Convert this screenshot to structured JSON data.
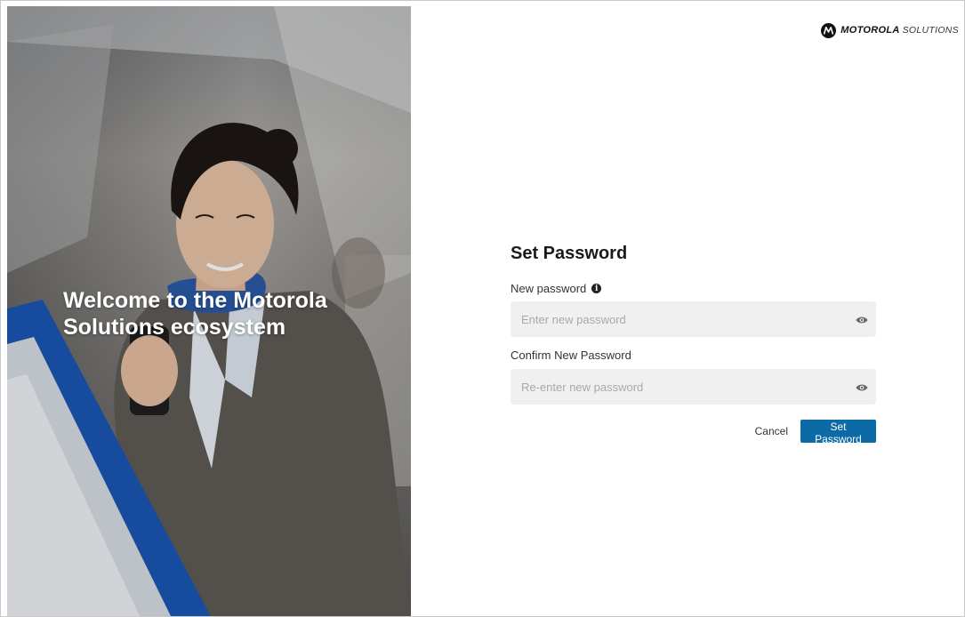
{
  "hero": {
    "heading_line1": "Welcome to the Motorola",
    "heading_line2": "Solutions ecosystem"
  },
  "brand": {
    "name_bold": "MOTOROLA",
    "name_light": "SOLUTIONS",
    "logo_icon": "motorola-m-icon"
  },
  "form": {
    "title": "Set Password",
    "new_password": {
      "label": "New password",
      "placeholder": "Enter new password",
      "value": "",
      "info_icon": "info-icon",
      "toggle_icon": "eye-icon"
    },
    "confirm_password": {
      "label": "Confirm New Password",
      "placeholder": "Re-enter new password",
      "value": "",
      "toggle_icon": "eye-icon"
    },
    "cancel_label": "Cancel",
    "submit_label": "Set Password"
  },
  "colors": {
    "primary": "#0c6aa6",
    "input_bg": "#f0f0f0",
    "hero_text": "#ffffff"
  }
}
